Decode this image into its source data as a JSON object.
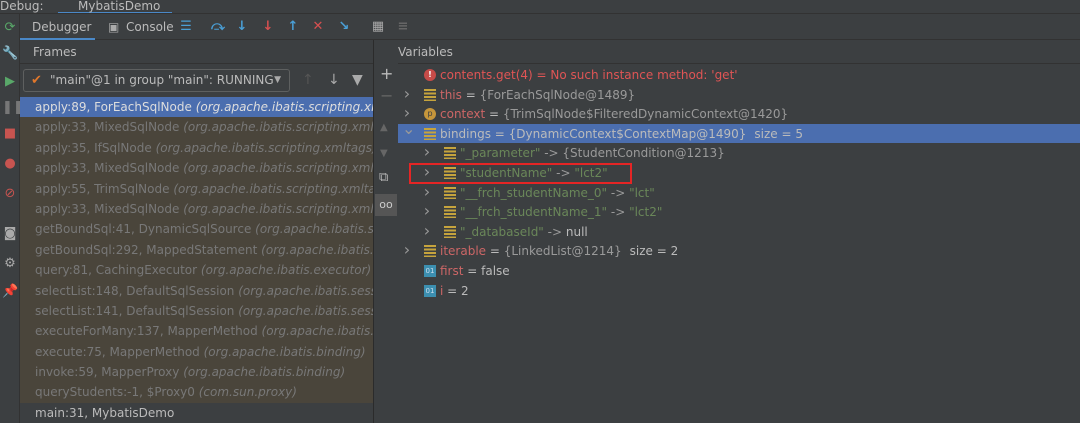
{
  "window": {
    "debug_label": "Debug:",
    "run_tab": "MybatisDemo"
  },
  "tabs": {
    "debugger": "Debugger",
    "console": "Console"
  },
  "frames_panel": {
    "title": "Frames",
    "thread": "\"main\"@1 in group \"main\": RUNNING",
    "frames": [
      {
        "method": "apply:89, ForEachSqlNode",
        "pkg": "(org.apache.ibatis.scripting.xmltags)",
        "selected": true
      },
      {
        "method": "apply:33, MixedSqlNode",
        "pkg": "(org.apache.ibatis.scripting.xmltags)"
      },
      {
        "method": "apply:35, IfSqlNode",
        "pkg": "(org.apache.ibatis.scripting.xmltags)"
      },
      {
        "method": "apply:33, MixedSqlNode",
        "pkg": "(org.apache.ibatis.scripting.xmltags)"
      },
      {
        "method": "apply:55, TrimSqlNode",
        "pkg": "(org.apache.ibatis.scripting.xmltags)"
      },
      {
        "method": "apply:33, MixedSqlNode",
        "pkg": "(org.apache.ibatis.scripting.xmltags)"
      },
      {
        "method": "getBoundSql:41, DynamicSqlSource",
        "pkg": "(org.apache.ibatis.scripting.xmltags)"
      },
      {
        "method": "getBoundSql:292, MappedStatement",
        "pkg": "(org.apache.ibatis.mapping)"
      },
      {
        "method": "query:81, CachingExecutor",
        "pkg": "(org.apache.ibatis.executor)"
      },
      {
        "method": "selectList:148, DefaultSqlSession",
        "pkg": "(org.apache.ibatis.session.defaults)"
      },
      {
        "method": "selectList:141, DefaultSqlSession",
        "pkg": "(org.apache.ibatis.session.defaults)"
      },
      {
        "method": "executeForMany:137, MapperMethod",
        "pkg": "(org.apache.ibatis.binding)"
      },
      {
        "method": "execute:75, MapperMethod",
        "pkg": "(org.apache.ibatis.binding)"
      },
      {
        "method": "invoke:59, MapperProxy",
        "pkg": "(org.apache.ibatis.binding)"
      },
      {
        "method": "queryStudents:-1, $Proxy0",
        "pkg": "(com.sun.proxy)"
      },
      {
        "method": "main:31, MybatisDemo",
        "pkg": ""
      }
    ]
  },
  "variables_panel": {
    "title": "Variables",
    "rows": [
      {
        "name": "contents.get(4)",
        "eq": " = ",
        "value": "No such instance method: 'get'"
      },
      {
        "name": "this",
        "eq": " = ",
        "value": "{ForEachSqlNode@1489}"
      },
      {
        "name": "context",
        "eq": " = ",
        "value": "{TrimSqlNode$FilteredDynamicContext@1420}"
      },
      {
        "name": "bindings",
        "eq": " = ",
        "value": "{DynamicContext$ContextMap@1490}",
        "extra": "size = 5"
      },
      {
        "key": "\"_parameter\"",
        "arrow": " -> ",
        "value": "{StudentCondition@1213}"
      },
      {
        "key": "\"studentName\"",
        "arrow": " -> ",
        "value": "\"lct2\""
      },
      {
        "key": "\"__frch_studentName_0\"",
        "arrow": " -> ",
        "value": "\"lct\""
      },
      {
        "key": "\"__frch_studentName_1\"",
        "arrow": " -> ",
        "value": "\"lct2\""
      },
      {
        "key": "\"_databaseId\"",
        "arrow": " -> ",
        "value": "null"
      },
      {
        "name": "iterable",
        "eq": " = ",
        "value": "{LinkedList@1214}",
        "extra": "size = 2"
      },
      {
        "name": "first",
        "eq": " = ",
        "value": "false"
      },
      {
        "name": "i",
        "eq": " = ",
        "value": "2"
      }
    ]
  }
}
